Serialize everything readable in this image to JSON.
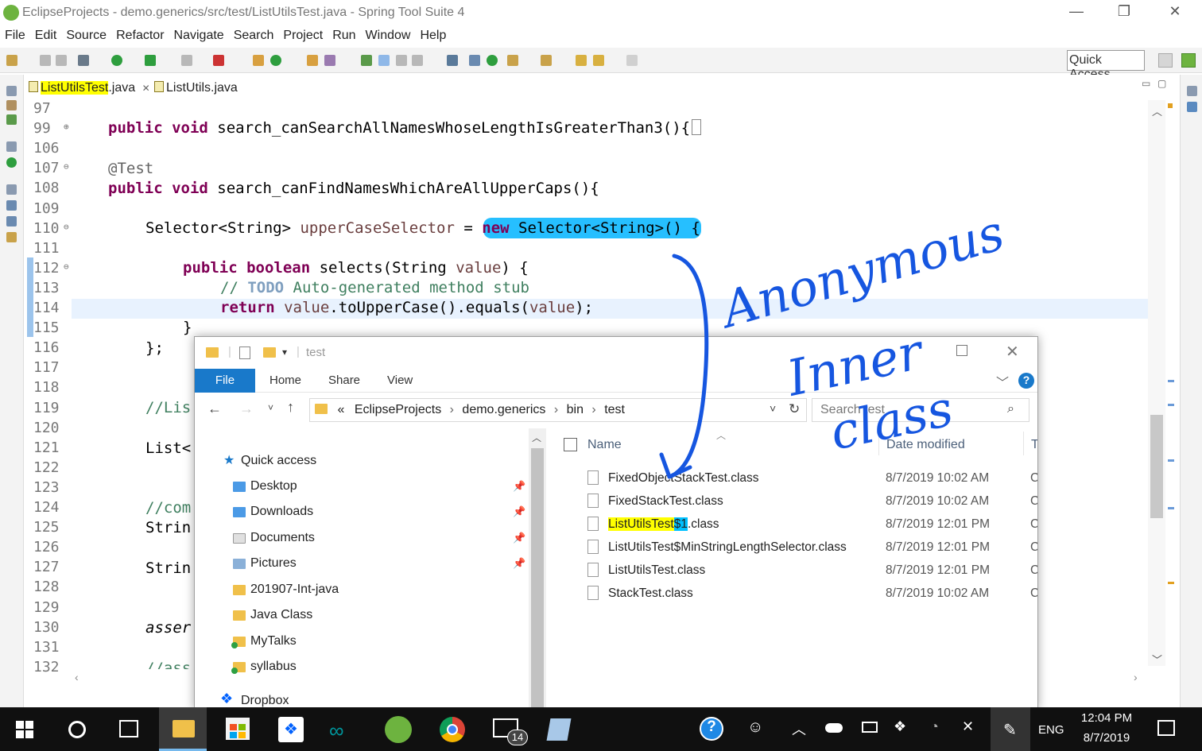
{
  "window": {
    "title": "EclipseProjects - demo.generics/src/test/ListUtilsTest.java - Spring Tool Suite 4",
    "minimize": "—",
    "restore": "❐",
    "close": "✕"
  },
  "menu": [
    "File",
    "Edit",
    "Source",
    "Refactor",
    "Navigate",
    "Search",
    "Project",
    "Run",
    "Window",
    "Help"
  ],
  "toolbar": {
    "quick_access": "Quick Access"
  },
  "tabs": [
    {
      "label_hl": "ListUtilsTest",
      "label_rest": ".java",
      "close": "✕"
    },
    {
      "label": "ListUtils.java"
    }
  ],
  "editor": {
    "lines": [
      {
        "n": "97",
        "marker": ""
      },
      {
        "n": "99",
        "marker": "⊕"
      },
      {
        "n": "106",
        "marker": ""
      },
      {
        "n": "107",
        "marker": "⊖"
      },
      {
        "n": "108",
        "marker": ""
      },
      {
        "n": "109",
        "marker": ""
      },
      {
        "n": "110",
        "marker": "⊖"
      },
      {
        "n": "111",
        "marker": ""
      },
      {
        "n": "112",
        "marker": "⊖"
      },
      {
        "n": "113",
        "marker": ""
      },
      {
        "n": "114",
        "marker": ""
      },
      {
        "n": "115",
        "marker": ""
      },
      {
        "n": "116",
        "marker": ""
      },
      {
        "n": "117",
        "marker": ""
      },
      {
        "n": "118",
        "marker": ""
      },
      {
        "n": "119",
        "marker": ""
      },
      {
        "n": "120",
        "marker": ""
      },
      {
        "n": "121",
        "marker": ""
      },
      {
        "n": "122",
        "marker": ""
      },
      {
        "n": "123",
        "marker": ""
      },
      {
        "n": "124",
        "marker": ""
      },
      {
        "n": "125",
        "marker": ""
      },
      {
        "n": "126",
        "marker": ""
      },
      {
        "n": "127",
        "marker": ""
      },
      {
        "n": "128",
        "marker": ""
      },
      {
        "n": "129",
        "marker": ""
      },
      {
        "n": "130",
        "marker": ""
      },
      {
        "n": "131",
        "marker": ""
      },
      {
        "n": "132",
        "marker": ""
      }
    ],
    "code": {
      "l99_kw": "public void",
      "l99_rest": " search_canSearchAllNamesWhoseLengthIsGreaterThan3(){",
      "l107": "@Test",
      "l108_kw": "public void",
      "l108_rest": " search_canFindNamesWhichAreAllUpperCaps(){",
      "l110_a": "Selector<String> ",
      "l110_var": "upperCaseSelector",
      "l110_b": " = ",
      "l110_new": "new",
      "l110_c": " Selector<String>() {",
      "l112_kw": "public boolean",
      "l112_rest": " selects(String ",
      "l112_var": "value",
      "l112_end": ") {",
      "l113_a": "// ",
      "l113_todo": "TODO",
      "l113_b": " Auto-generated method stub",
      "l114_kw": "return",
      "l114_a": " ",
      "l114_var": "value",
      "l114_b": ".toUpperCase().equals(",
      "l114_var2": "value",
      "l114_c": ");",
      "l115": "}",
      "l116": "};",
      "l119": "//Lis",
      "l121": "List<",
      "l124": "//com",
      "l125": "Strin",
      "l127": "Strin",
      "l130": "asser",
      "l132": "//ass"
    }
  },
  "explorer": {
    "title": "test",
    "ribbon": [
      "File",
      "Home",
      "Share",
      "View"
    ],
    "help": "?",
    "address": [
      "«",
      "EclipseProjects",
      "demo.generics",
      "bin",
      "test"
    ],
    "search_placeholder": "Search test",
    "nav": {
      "quick_access": "Quick access",
      "items": [
        "Desktop",
        "Downloads",
        "Documents",
        "Pictures",
        "201907-Int-java",
        "Java Class",
        "MyTalks",
        "syllabus"
      ],
      "dropbox": "Dropbox"
    },
    "columns": {
      "name": "Name",
      "date": "Date modified",
      "type": "T"
    },
    "files": [
      {
        "name": "FixedObjectStackTest.class",
        "date": "8/7/2019 10:02 AM",
        "type": "C"
      },
      {
        "name": "FixedStackTest.class",
        "date": "8/7/2019 10:02 AM",
        "type": "C"
      },
      {
        "name_a": "ListUtilsTest",
        "name_b": "$1",
        "name_c": ".class",
        "date": "8/7/2019 12:01 PM",
        "type": "C"
      },
      {
        "name": "ListUtilsTest$MinStringLengthSelector.class",
        "date": "8/7/2019 12:01 PM",
        "type": "C"
      },
      {
        "name": "ListUtilsTest.class",
        "date": "8/7/2019 12:01 PM",
        "type": "C"
      },
      {
        "name": "StackTest.class",
        "date": "8/7/2019 10:02 AM",
        "type": "C"
      }
    ]
  },
  "annotation": {
    "line1": "Anonymous",
    "line2": "Inner",
    "line3": "class",
    "color": "#1656e0"
  },
  "taskbar": {
    "lang": "ENG",
    "time": "12:04 PM",
    "date": "8/7/2019",
    "mail_badge": "14"
  }
}
